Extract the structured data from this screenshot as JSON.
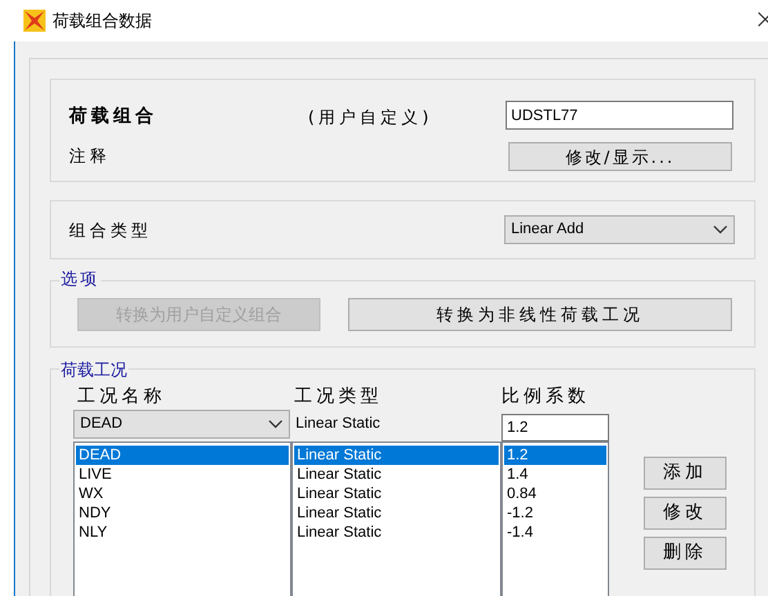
{
  "window": {
    "title": "荷载组合数据"
  },
  "combination": {
    "label": "荷载组合",
    "note": "(用户自定义)",
    "name_value": "UDSTL77",
    "comment_label": "注释",
    "modify_button": "修改/显示..."
  },
  "combination_type": {
    "label": "组合类型",
    "value": "Linear Add"
  },
  "options": {
    "legend": "选项",
    "buttons": [
      {
        "label": "转换为用户自定义组合",
        "disabled": true
      },
      {
        "label": "转换为非线性荷载工况",
        "disabled": false
      }
    ]
  },
  "load_cases": {
    "legend": "荷载工况",
    "columns": [
      "工况名称",
      "工况类型",
      "比例系数"
    ],
    "editor": {
      "name": "DEAD",
      "type": "Linear Static",
      "scale": "1.2"
    },
    "rows": [
      {
        "name": "DEAD",
        "type": "Linear Static",
        "scale": "1.2",
        "selected": true
      },
      {
        "name": "LIVE",
        "type": "Linear Static",
        "scale": "1.4",
        "selected": false
      },
      {
        "name": "WX",
        "type": "Linear Static",
        "scale": "0.84",
        "selected": false
      },
      {
        "name": "NDY",
        "type": "Linear Static",
        "scale": "-1.2",
        "selected": false
      },
      {
        "name": "NLY",
        "type": "Linear Static",
        "scale": "-1.4",
        "selected": false
      }
    ],
    "buttons": [
      "添加",
      "修改",
      "删除"
    ]
  }
}
